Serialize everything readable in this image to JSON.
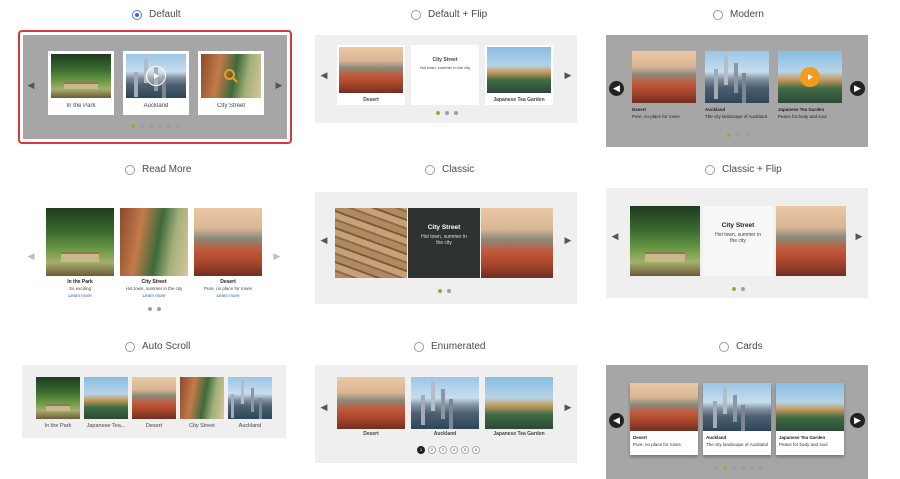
{
  "options": [
    {
      "label": "Default",
      "selected": true
    },
    {
      "label": "Default + Flip",
      "selected": false
    },
    {
      "label": "Modern",
      "selected": false
    },
    {
      "label": "Read More",
      "selected": false
    },
    {
      "label": "Classic",
      "selected": false
    },
    {
      "label": "Classic + Flip",
      "selected": false
    },
    {
      "label": "Auto Scroll",
      "selected": false
    },
    {
      "label": "Enumerated",
      "selected": false
    },
    {
      "label": "Cards",
      "selected": false
    }
  ],
  "slides": {
    "park": {
      "title": "In the Park",
      "desc": "So exciting"
    },
    "auckland": {
      "title": "Auckland",
      "desc": "The city landscape of Auckland"
    },
    "city": {
      "title": "City Street",
      "desc": "Hot town, summer in the city"
    },
    "desert": {
      "title": "Desert",
      "desc": "Pure, no place for roses"
    },
    "japan": {
      "title": "Japanese Tea Garden",
      "short": "Japanese Tea...",
      "desc": "Peace for body and soul"
    }
  },
  "read_more": "Learn more",
  "enumerated_pages": [
    "1",
    "2",
    "3",
    "4",
    "5",
    "6"
  ],
  "colors": {
    "accent_dot": "#8ab04a",
    "selected_border": "#d9363e",
    "radio_selected": "#2e6bd6",
    "play_orange": "#f29b1d"
  },
  "icons": {
    "prev": "chevron-left-icon",
    "next": "chevron-right-icon",
    "play": "play-icon",
    "zoom": "magnifier-icon"
  }
}
